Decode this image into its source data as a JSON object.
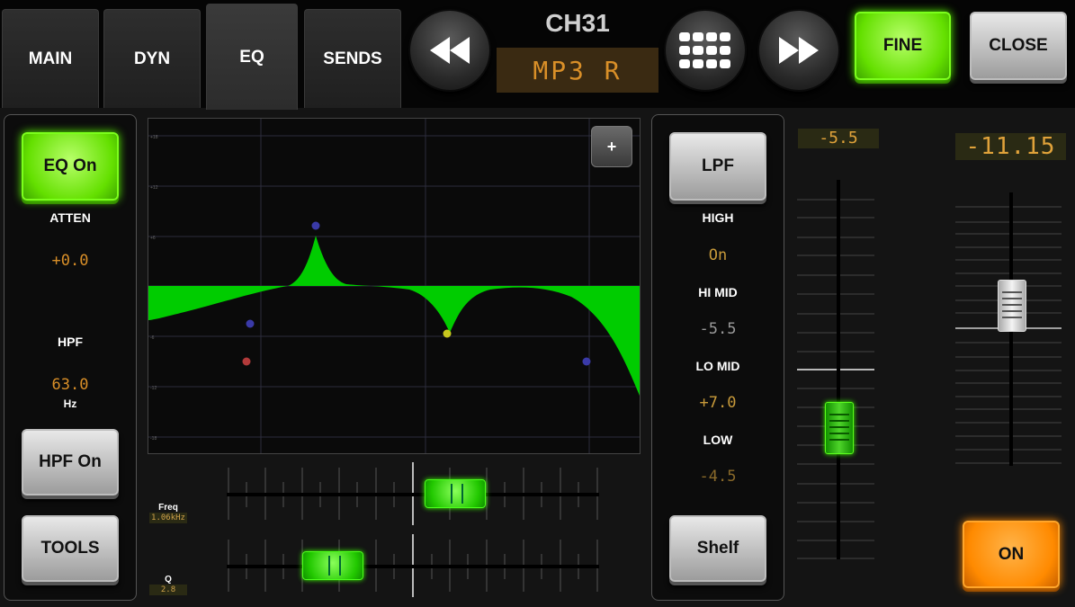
{
  "tabs": [
    {
      "label": "MAIN"
    },
    {
      "label": "DYN"
    },
    {
      "label": "EQ"
    },
    {
      "label": "SENDS"
    }
  ],
  "channel": {
    "number": "CH31",
    "name": "MP3 R"
  },
  "buttons": {
    "fine": "FINE",
    "close": "CLOSE",
    "eq_on": "EQ On",
    "hpf_on": "HPF On",
    "tools": "TOOLS",
    "lpf": "LPF",
    "shelf": "Shelf",
    "on": "ON",
    "zoom": "+"
  },
  "left_panel": {
    "atten_label": "ATTEN",
    "atten_value": "+0.0",
    "hpf_label": "HPF",
    "hpf_value": "63.0",
    "hpf_unit": "Hz"
  },
  "bands": [
    {
      "label": "HIGH",
      "value": "On"
    },
    {
      "label": "HI MID",
      "value": "-5.5"
    },
    {
      "label": "LO MID",
      "value": "+7.0"
    },
    {
      "label": "LOW",
      "value": "-4.5"
    }
  ],
  "sliders": {
    "freq_label": "Freq",
    "freq_value": "1.06kHz",
    "q_label": "Q",
    "q_value": "2.8"
  },
  "faders": {
    "gain_readout": "-5.5",
    "level_readout": "-11.15"
  },
  "colors": {
    "accent_green": "#5cff00",
    "readout_amber": "#d98f28",
    "on_orange": "#ff8a00"
  }
}
